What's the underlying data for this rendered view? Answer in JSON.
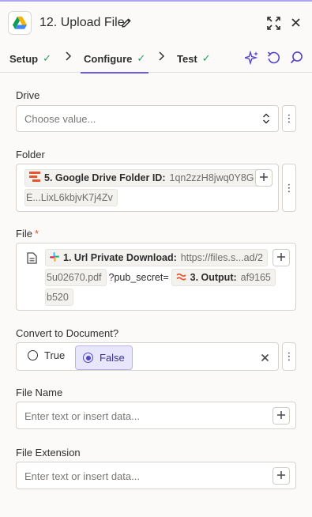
{
  "header": {
    "title": "12. Upload File",
    "icons": {
      "app": "google-drive-icon",
      "edit": "pencil-icon",
      "expand": "expand-icon",
      "close": "close-icon"
    }
  },
  "tabs": [
    {
      "label": "Setup",
      "done": true
    },
    {
      "label": "Configure",
      "done": true,
      "active": true
    },
    {
      "label": "Test",
      "done": true
    }
  ],
  "tools": [
    "ai-sparkle-icon",
    "refresh-icon",
    "search-icon"
  ],
  "fields": {
    "drive": {
      "label": "Drive",
      "placeholder": "Choose value..."
    },
    "folder": {
      "label": "Folder",
      "pill_label": "5. Google Drive Folder ID:",
      "pill_value_1": "1qn2zzH8jwq0Y8G",
      "pill_value_2": "E...LixL6kbjvK7j4Zv"
    },
    "file": {
      "label": "File",
      "required_mark": "*",
      "pill1_label": "1. Url Private Download:",
      "pill1_value_1": "https://files.s...ad/2",
      "pill1_value_2": "5u02670.pdf",
      "text_between": "?pub_secret=",
      "pill2_label": "3. Output:",
      "pill2_value_1": "af9165",
      "pill2_value_2": "b520"
    },
    "convert": {
      "label": "Convert to Document?",
      "options": [
        {
          "label": "True",
          "selected": false
        },
        {
          "label": "False",
          "selected": true
        }
      ]
    },
    "file_name": {
      "label": "File Name",
      "placeholder": "Enter text or insert data..."
    },
    "file_extension": {
      "label": "File Extension",
      "placeholder": "Enter text or insert data..."
    }
  },
  "colors": {
    "accent": "#6c5ce7",
    "check": "#2e9b5b",
    "required": "#d8553b"
  }
}
